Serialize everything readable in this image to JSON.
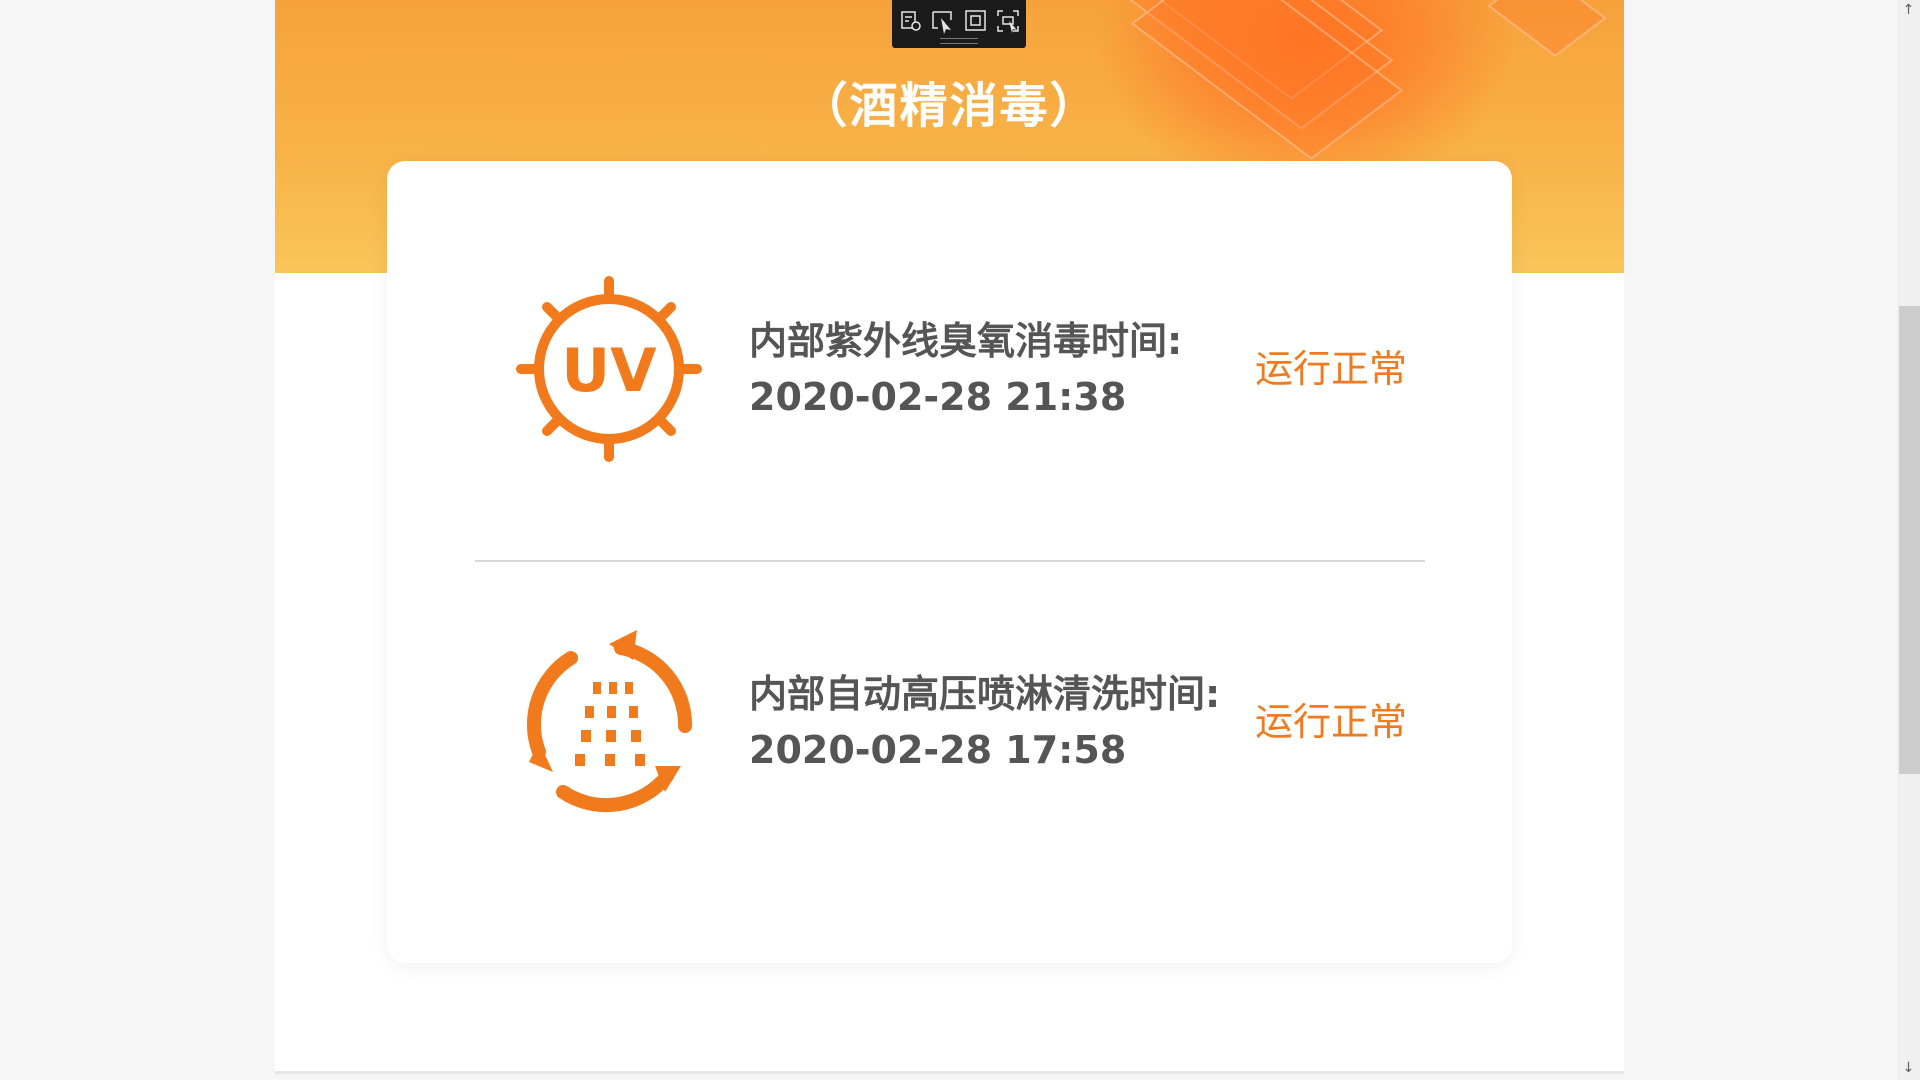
{
  "hero": {
    "title_fragment": "",
    "subtitle": "（酒精消毒）"
  },
  "items": [
    {
      "label": "内部紫外线臭氧消毒时间:",
      "time": "2020-02-28 21:38",
      "status": "运行正常",
      "icon": "uv-icon",
      "icon_text": "UV"
    },
    {
      "label": "内部自动高压喷淋清洗时间:",
      "time": "2020-02-28 17:58",
      "status": "运行正常",
      "icon": "spray-cycle-icon"
    }
  ],
  "toolbar": {
    "buttons": [
      "settings-icon",
      "select-pointer-icon",
      "square-frame-icon",
      "fit-screen-icon"
    ]
  },
  "scrollbar": {
    "up_arrow": "↑",
    "down_arrow": "↓"
  },
  "colors": {
    "accent": "#f07a1c",
    "hero_top": "#f6a23c",
    "hero_bottom": "#f9c55a",
    "text": "#555555"
  }
}
